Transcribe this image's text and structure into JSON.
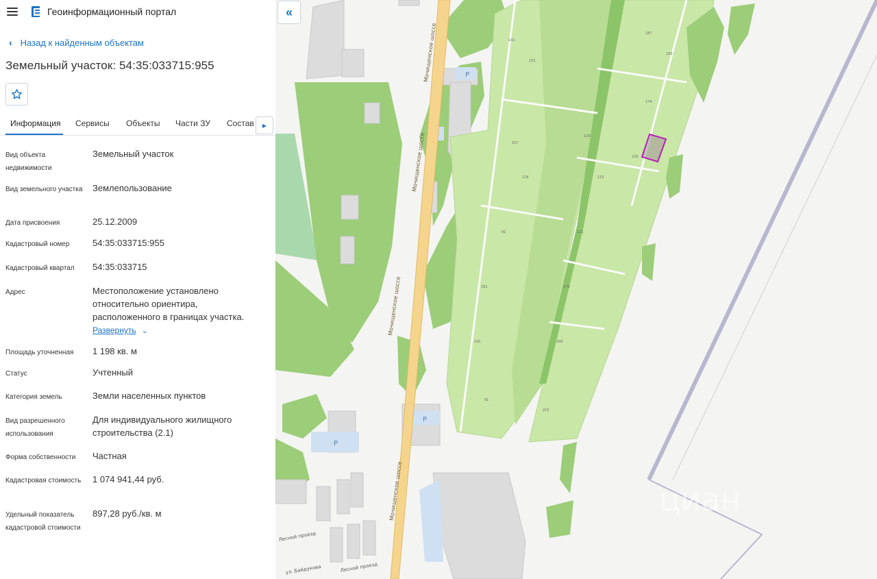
{
  "app": {
    "title": "Геоинформационный портал"
  },
  "nav": {
    "back_label": "Назад к найденным объектам"
  },
  "object": {
    "title": "Земельный участок: 54:35:033715:955"
  },
  "tabs": [
    {
      "label": "Информация",
      "active": true
    },
    {
      "label": "Сервисы"
    },
    {
      "label": "Объекты"
    },
    {
      "label": "Части ЗУ"
    },
    {
      "label": "Состав"
    }
  ],
  "info": [
    {
      "label": "Вид объекта недвижимости",
      "value": "Земельный участок"
    },
    {
      "label": "Вид земельного участка",
      "value": "Землепользование"
    },
    {
      "label": "Дата присвоения",
      "value": "25.12.2009"
    },
    {
      "label": "Кадастровый номер",
      "value": "54:35:033715:955"
    },
    {
      "label": "Кадастровый квартал",
      "value": "54:35:033715"
    },
    {
      "label": "Адрес",
      "value": "Местоположение установлено относительно ориентира, расположенного в границах участка.",
      "expand": "Развернуть"
    },
    {
      "label": "Площадь уточненная",
      "value": "1 198 кв. м"
    },
    {
      "label": "Статус",
      "value": "Учтенный"
    },
    {
      "label": "Категория земель",
      "value": "Земли населенных пунктов"
    },
    {
      "label": "Вид разрешенного использования",
      "value": "Для индивидуального жилищного строительства (2.1)"
    },
    {
      "label": "Форма собственности",
      "value": "Частная"
    },
    {
      "label": "Кадастровая стоимость",
      "value": "1 074 941,44 руб."
    },
    {
      "label": "Удельный показатель кадастровой стоимости",
      "value": "897,28 руб./кв. м"
    }
  ],
  "map": {
    "road_label": "Мочищенское шоссе",
    "street_labels": [
      "Лесной проезд",
      "Лесной проезд",
      "ул. Байдукова"
    ],
    "parking_label": "P",
    "watermark": "циан",
    "colors": {
      "background": "#f4f4f2",
      "plot_green": "#c9e7a6",
      "forest": "#9ccd79",
      "road": "#f5d58d",
      "highlight": "#b81fb8",
      "airfield": "#b7b7cf"
    }
  }
}
